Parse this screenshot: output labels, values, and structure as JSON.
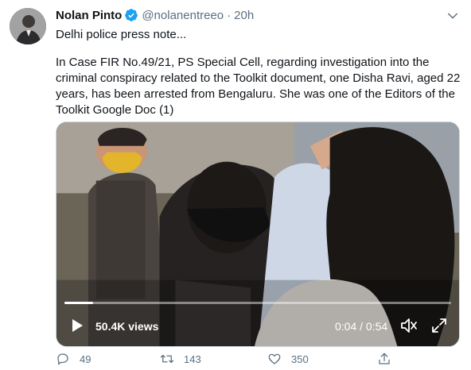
{
  "author": {
    "name": "Nolan Pinto",
    "handle": "@nolanentreeo",
    "separator": "·",
    "time": "20h"
  },
  "tweet": {
    "first_line": "Delhi police press note...",
    "body_lines": [
      "In Case FIR No.49/21, PS Special Cell, regarding investigation into the",
      "criminal conspiracy related to the Toolkit document, one Disha Ravi, aged 22",
      "years, has been arrested from Bengaluru. She was one of the Editors of the",
      "Toolkit Google Doc (1)"
    ]
  },
  "video": {
    "views": "50.4K views",
    "timecode": "0:04 / 0:54",
    "progress_fraction": 0.074
  },
  "actions": {
    "replies": "49",
    "retweets": "143",
    "likes": "350"
  },
  "colors": {
    "verified": "#1da1f2",
    "secondary_text": "#5b7083",
    "retweet_icon": "#5b7083"
  },
  "icons": [
    "verified-badge-icon",
    "chevron-down-icon",
    "play-icon",
    "volume-icon",
    "fullscreen-icon",
    "reply-icon",
    "retweet-icon",
    "like-icon",
    "share-icon"
  ]
}
